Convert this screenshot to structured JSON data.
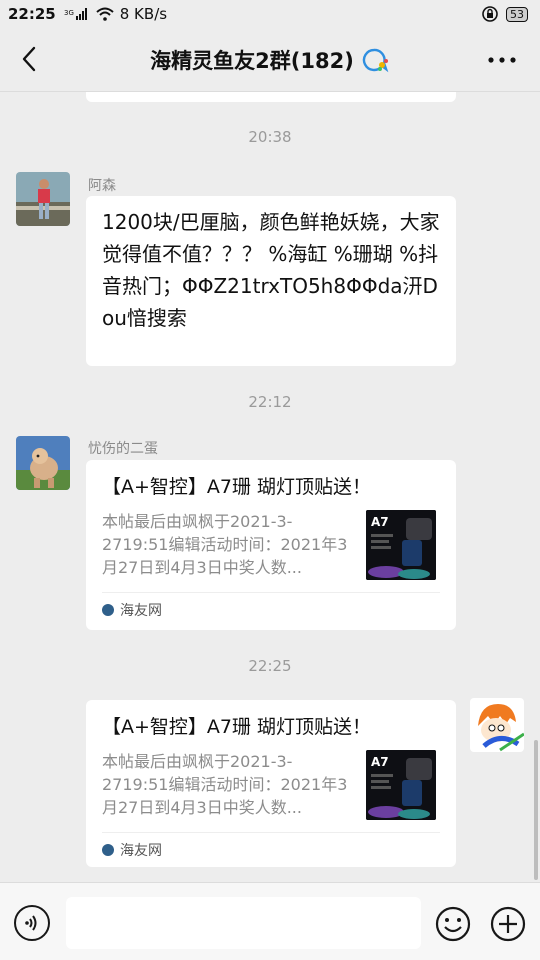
{
  "status": {
    "time": "22:25",
    "network": "3G",
    "speed": "8 KB/s",
    "battery": "53"
  },
  "header": {
    "title": "海精灵鱼友2群(182)",
    "icons": {
      "back": "back-arrow-icon",
      "group": "group-chat-icon",
      "more": "more-options-icon"
    }
  },
  "messages": {
    "t1": "20:38",
    "m1": {
      "sender": "阿森",
      "text": "1200块/巴厘脑，颜色鲜艳妖娆，大家觉得值不值？？？ %海缸 %珊瑚 %抖音热门；ΦΦZ21trxTO5h8ΦΦda汧Dou愔搜索"
    },
    "t2": "22:12",
    "m2": {
      "sender": "忧伤的二蛋",
      "card_title": "【A+智控】A7珊 瑚灯顶贴送！",
      "card_desc": "本帖最后由飒枫于2021-3-2719:51编辑活动时间：2021年3月27日到4月3日中奖人数...",
      "card_source": "海友网",
      "thumb_label": "A7"
    },
    "t3": "22:25",
    "m3": {
      "card_title": "【A+智控】A7珊 瑚灯顶贴送！",
      "card_desc": "本帖最后由飒枫于2021-3-2719:51编辑活动时间：2021年3月27日到4月3日中奖人数...",
      "card_source": "海友网",
      "thumb_label": "A7"
    }
  },
  "input": {
    "icons": {
      "voice": "voice-icon",
      "emoji": "emoji-icon",
      "plus": "plus-icon"
    }
  }
}
